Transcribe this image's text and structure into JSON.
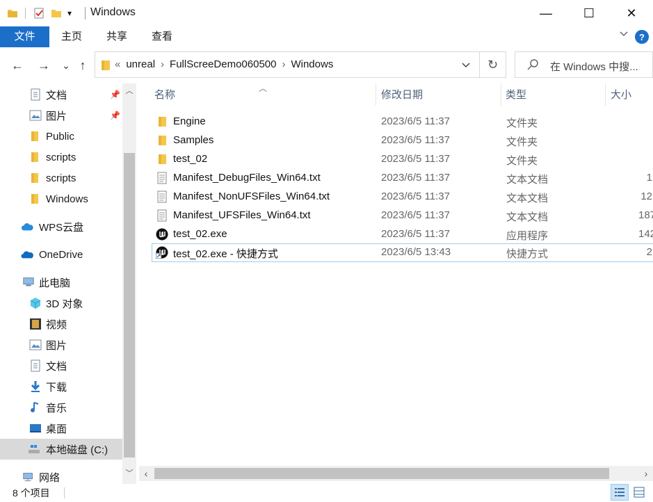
{
  "window": {
    "title": "Windows",
    "minimize": "—",
    "maximize": "☐",
    "close": "✕"
  },
  "ribbon": {
    "tabs": [
      "文件",
      "主页",
      "共享",
      "查看"
    ],
    "expand_icon": "chevron-down-icon",
    "help_label": "?"
  },
  "nav": {
    "back": "←",
    "forward": "→",
    "recent": "⌄",
    "up": "↑",
    "overflow": "«",
    "breadcrumb": [
      "unreal",
      "FullScreeDemo060500",
      "Windows"
    ],
    "separator": "›",
    "refresh": "↻",
    "search_placeholder": "在 Windows 中搜..."
  },
  "sidebar": {
    "items": [
      {
        "label": "文档",
        "icon": "document-icon",
        "pinned": true
      },
      {
        "label": "图片",
        "icon": "pictures-icon",
        "pinned": true
      },
      {
        "label": "Public",
        "icon": "folder-icon",
        "pinned": false
      },
      {
        "label": "scripts",
        "icon": "folder-icon",
        "pinned": false
      },
      {
        "label": "scripts",
        "icon": "folder-icon",
        "pinned": false
      },
      {
        "label": "Windows",
        "icon": "folder-icon",
        "pinned": false
      },
      {
        "label": "WPS云盘",
        "icon": "cloud-icon",
        "pinned": false
      },
      {
        "label": "OneDrive",
        "icon": "onedrive-icon",
        "pinned": false
      },
      {
        "label": "此电脑",
        "icon": "computer-icon",
        "pinned": false
      },
      {
        "label": "3D 对象",
        "icon": "3d-objects-icon",
        "pinned": false
      },
      {
        "label": "视频",
        "icon": "video-icon",
        "pinned": false
      },
      {
        "label": "图片",
        "icon": "pictures-icon",
        "pinned": false
      },
      {
        "label": "文档",
        "icon": "document-icon",
        "pinned": false
      },
      {
        "label": "下载",
        "icon": "download-icon",
        "pinned": false
      },
      {
        "label": "音乐",
        "icon": "music-icon",
        "pinned": false
      },
      {
        "label": "桌面",
        "icon": "desktop-icon",
        "pinned": false
      },
      {
        "label": "本地磁盘 (C:)",
        "icon": "drive-icon",
        "pinned": false
      },
      {
        "label": "网络",
        "icon": "network-icon",
        "pinned": false
      }
    ]
  },
  "columns": {
    "name": "名称",
    "date": "修改日期",
    "type": "类型",
    "size": "大小"
  },
  "files": [
    {
      "name": "Engine",
      "date": "2023/6/5 11:37",
      "type": "文件夹",
      "size": "",
      "icon": "folder-icon"
    },
    {
      "name": "Samples",
      "date": "2023/6/5 11:37",
      "type": "文件夹",
      "size": "",
      "icon": "folder-icon"
    },
    {
      "name": "test_02",
      "date": "2023/6/5 11:37",
      "type": "文件夹",
      "size": "",
      "icon": "folder-icon"
    },
    {
      "name": "Manifest_DebugFiles_Win64.txt",
      "date": "2023/6/5 11:37",
      "type": "文本文档",
      "size": "1",
      "icon": "text-file-icon"
    },
    {
      "name": "Manifest_NonUFSFiles_Win64.txt",
      "date": "2023/6/5 11:37",
      "type": "文本文档",
      "size": "12",
      "icon": "text-file-icon"
    },
    {
      "name": "Manifest_UFSFiles_Win64.txt",
      "date": "2023/6/5 11:37",
      "type": "文本文档",
      "size": "187",
      "icon": "text-file-icon"
    },
    {
      "name": "test_02.exe",
      "date": "2023/6/5 11:37",
      "type": "应用程序",
      "size": "142",
      "icon": "unreal-app-icon"
    },
    {
      "name": "test_02.exe - 快捷方式",
      "date": "2023/6/5 13:43",
      "type": "快捷方式",
      "size": "2",
      "icon": "shortcut-icon"
    }
  ],
  "status": {
    "item_count": "8 个项目"
  },
  "colors": {
    "accent": "#1c6fc9",
    "folder": "#f4c64a",
    "selected_row_border": "#9ccbf1"
  }
}
